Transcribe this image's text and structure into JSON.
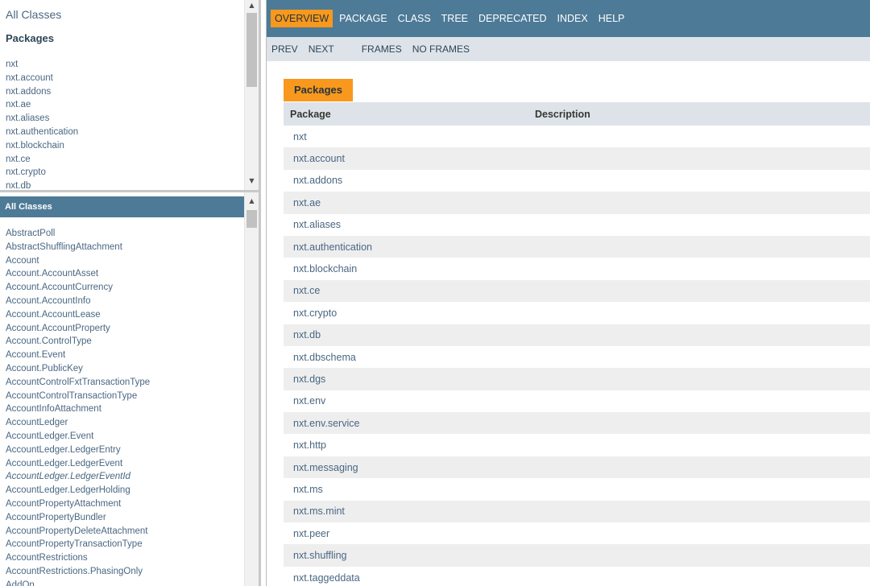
{
  "left_top": {
    "all_classes_link": "All Classes",
    "packages_heading": "Packages",
    "packages": [
      "nxt",
      "nxt.account",
      "nxt.addons",
      "nxt.ae",
      "nxt.aliases",
      "nxt.authentication",
      "nxt.blockchain",
      "nxt.ce",
      "nxt.crypto",
      "nxt.db"
    ]
  },
  "left_bottom": {
    "heading": "All Classes",
    "classes": [
      "AbstractPoll",
      "AbstractShufflingAttachment",
      "Account",
      "Account.AccountAsset",
      "Account.AccountCurrency",
      "Account.AccountInfo",
      "Account.AccountLease",
      "Account.AccountProperty",
      "Account.ControlType",
      "Account.Event",
      "Account.PublicKey",
      "AccountControlFxtTransactionType",
      "AccountControlTransactionType",
      "AccountInfoAttachment",
      "AccountLedger",
      "AccountLedger.Event",
      "AccountLedger.LedgerEntry",
      "AccountLedger.LedgerEvent",
      "AccountLedger.LedgerEventId",
      "AccountLedger.LedgerHolding",
      "AccountPropertyAttachment",
      "AccountPropertyBundler",
      "AccountPropertyDeleteAttachment",
      "AccountPropertyTransactionType",
      "AccountRestrictions",
      "AccountRestrictions.PhasingOnly",
      "AddOn"
    ],
    "italic_index": 18
  },
  "topnav": {
    "items": [
      "OVERVIEW",
      "PACKAGE",
      "CLASS",
      "TREE",
      "DEPRECATED",
      "INDEX",
      "HELP"
    ]
  },
  "subnav": {
    "prev": "PREV",
    "next": "NEXT",
    "frames": "FRAMES",
    "no_frames": "NO FRAMES"
  },
  "main": {
    "caption": "Packages",
    "col_package": "Package",
    "col_description": "Description",
    "packages": [
      "nxt",
      "nxt.account",
      "nxt.addons",
      "nxt.ae",
      "nxt.aliases",
      "nxt.authentication",
      "nxt.blockchain",
      "nxt.ce",
      "nxt.crypto",
      "nxt.db",
      "nxt.dbschema",
      "nxt.dgs",
      "nxt.env",
      "nxt.env.service",
      "nxt.http",
      "nxt.messaging",
      "nxt.ms",
      "nxt.ms.mint",
      "nxt.peer",
      "nxt.shuffling",
      "nxt.taggeddata"
    ]
  },
  "colors": {
    "nav_blue": "#4d7a97",
    "active_orange": "#f8981d",
    "subnav_gray": "#dee3e9",
    "alt_row": "#eeeeef"
  }
}
